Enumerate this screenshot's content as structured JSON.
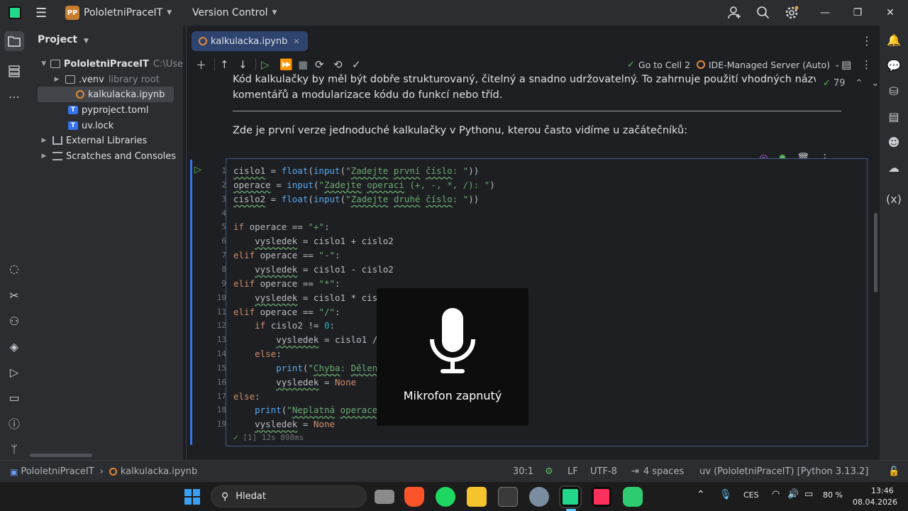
{
  "titlebar": {
    "project_badge": "PP",
    "project_name": "PololetniPraceIT",
    "vcs_label": "Version Control"
  },
  "project_panel": {
    "title": "Project",
    "tree": [
      {
        "label": "PololetniPraceIT",
        "hint": "C:\\Use"
      },
      {
        "label": ".venv",
        "hint": "library root"
      },
      {
        "label": "kalkulacka.ipynb"
      },
      {
        "label": "pyproject.toml"
      },
      {
        "label": "uv.lock"
      },
      {
        "label": "External Libraries"
      },
      {
        "label": "Scratches and Consoles"
      }
    ]
  },
  "editor": {
    "tab_label": "kalkulacka.ipynb",
    "toolbar": {
      "goto_label": "Go to Cell 2",
      "server_label": "IDE-Managed Server (Auto)"
    },
    "inspection_count": "79",
    "markdown": {
      "para1_line1": "Kód kalkulačky by měl být dobře strukturovaný, čitelný a snadno udržovatelný. To zahrnuje použití vhodných názvů proměnných,",
      "para1_line2": "komentářů a modularizace kódu do funkcí nebo tříd.",
      "para2": "Zde je první verze jednoduché kalkulačky v Pythonu, kterou často vidíme u začátečníků:"
    },
    "line_numbers": [
      "1",
      "2",
      "3",
      "4",
      "5",
      "6",
      "7",
      "8",
      "9",
      "10",
      "11",
      "12",
      "13",
      "14",
      "15",
      "16",
      "17",
      "18",
      "19"
    ],
    "exec_status": "[1] 12s 898ms"
  },
  "mic_popup": {
    "label": "Mikrofon zapnutý"
  },
  "statusbar": {
    "breadcrumb_project": "PololetniPraceIT",
    "breadcrumb_file": "kalkulacka.ipynb",
    "position": "30:1",
    "line_sep": "LF",
    "encoding": "UTF-8",
    "indent": "4 spaces",
    "interpreter": "uv (PololetniPraceIT) [Python 3.13.2]"
  },
  "taskbar": {
    "search_placeholder": "Hledat",
    "lang": "CES",
    "battery": "80 %",
    "time": "13:46",
    "date": "08.04.2026"
  },
  "colors": {
    "accent": "#3574f0",
    "keyword": "#cf8e6d",
    "string": "#6aab73",
    "number": "#2aacb8"
  }
}
